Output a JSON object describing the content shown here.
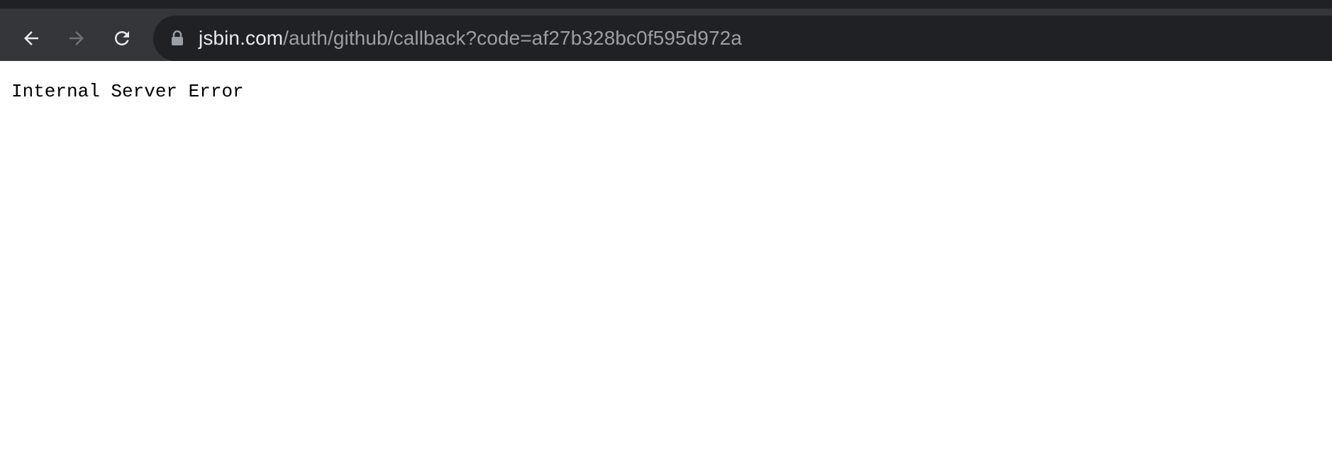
{
  "browser": {
    "url_host": "jsbin.com",
    "url_path": "/auth/github/callback?code=af27b328bc0f595d972a",
    "icons": {
      "back": "back-arrow-icon",
      "forward": "forward-arrow-icon",
      "reload": "reload-icon",
      "lock": "lock-icon"
    }
  },
  "page": {
    "body_text": "Internal Server Error"
  },
  "colors": {
    "toolbar_bg": "#35363a",
    "omnibox_bg": "#202124",
    "url_host": "#e8eaed",
    "url_path": "#9aa0a6",
    "page_bg": "#ffffff"
  }
}
